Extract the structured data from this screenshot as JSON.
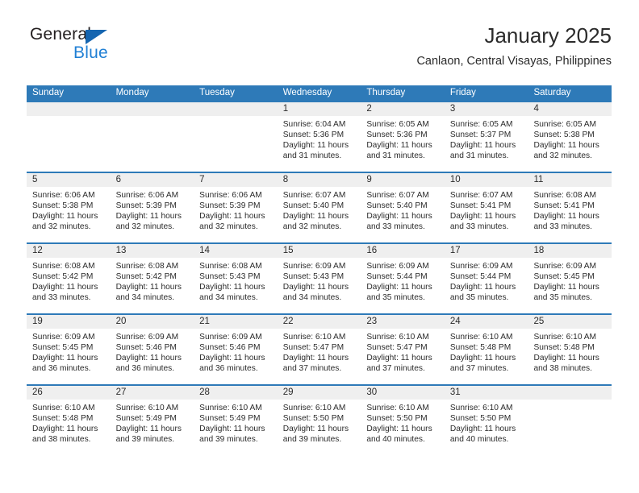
{
  "brand": {
    "name_top": "General",
    "name_bottom": "Blue",
    "triangle_color": "#1565b0",
    "blue_color": "#1f7fd4"
  },
  "header": {
    "title": "January 2025",
    "subtitle": "Canlaon, Central Visayas, Philippines"
  },
  "theme": {
    "header_blue": "#2e7ab8",
    "daynum_band": "#efefef",
    "text": "#2b2b2b"
  },
  "calendar": {
    "weekday_headers": [
      "Sunday",
      "Monday",
      "Tuesday",
      "Wednesday",
      "Thursday",
      "Friday",
      "Saturday"
    ],
    "weeks": [
      [
        {
          "day": "",
          "sunrise": "",
          "sunset": "",
          "daylight_line1": "",
          "daylight_line2": ""
        },
        {
          "day": "",
          "sunrise": "",
          "sunset": "",
          "daylight_line1": "",
          "daylight_line2": ""
        },
        {
          "day": "",
          "sunrise": "",
          "sunset": "",
          "daylight_line1": "",
          "daylight_line2": ""
        },
        {
          "day": "1",
          "sunrise": "Sunrise: 6:04 AM",
          "sunset": "Sunset: 5:36 PM",
          "daylight_line1": "Daylight: 11 hours",
          "daylight_line2": "and 31 minutes."
        },
        {
          "day": "2",
          "sunrise": "Sunrise: 6:05 AM",
          "sunset": "Sunset: 5:36 PM",
          "daylight_line1": "Daylight: 11 hours",
          "daylight_line2": "and 31 minutes."
        },
        {
          "day": "3",
          "sunrise": "Sunrise: 6:05 AM",
          "sunset": "Sunset: 5:37 PM",
          "daylight_line1": "Daylight: 11 hours",
          "daylight_line2": "and 31 minutes."
        },
        {
          "day": "4",
          "sunrise": "Sunrise: 6:05 AM",
          "sunset": "Sunset: 5:38 PM",
          "daylight_line1": "Daylight: 11 hours",
          "daylight_line2": "and 32 minutes."
        }
      ],
      [
        {
          "day": "5",
          "sunrise": "Sunrise: 6:06 AM",
          "sunset": "Sunset: 5:38 PM",
          "daylight_line1": "Daylight: 11 hours",
          "daylight_line2": "and 32 minutes."
        },
        {
          "day": "6",
          "sunrise": "Sunrise: 6:06 AM",
          "sunset": "Sunset: 5:39 PM",
          "daylight_line1": "Daylight: 11 hours",
          "daylight_line2": "and 32 minutes."
        },
        {
          "day": "7",
          "sunrise": "Sunrise: 6:06 AM",
          "sunset": "Sunset: 5:39 PM",
          "daylight_line1": "Daylight: 11 hours",
          "daylight_line2": "and 32 minutes."
        },
        {
          "day": "8",
          "sunrise": "Sunrise: 6:07 AM",
          "sunset": "Sunset: 5:40 PM",
          "daylight_line1": "Daylight: 11 hours",
          "daylight_line2": "and 32 minutes."
        },
        {
          "day": "9",
          "sunrise": "Sunrise: 6:07 AM",
          "sunset": "Sunset: 5:40 PM",
          "daylight_line1": "Daylight: 11 hours",
          "daylight_line2": "and 33 minutes."
        },
        {
          "day": "10",
          "sunrise": "Sunrise: 6:07 AM",
          "sunset": "Sunset: 5:41 PM",
          "daylight_line1": "Daylight: 11 hours",
          "daylight_line2": "and 33 minutes."
        },
        {
          "day": "11",
          "sunrise": "Sunrise: 6:08 AM",
          "sunset": "Sunset: 5:41 PM",
          "daylight_line1": "Daylight: 11 hours",
          "daylight_line2": "and 33 minutes."
        }
      ],
      [
        {
          "day": "12",
          "sunrise": "Sunrise: 6:08 AM",
          "sunset": "Sunset: 5:42 PM",
          "daylight_line1": "Daylight: 11 hours",
          "daylight_line2": "and 33 minutes."
        },
        {
          "day": "13",
          "sunrise": "Sunrise: 6:08 AM",
          "sunset": "Sunset: 5:42 PM",
          "daylight_line1": "Daylight: 11 hours",
          "daylight_line2": "and 34 minutes."
        },
        {
          "day": "14",
          "sunrise": "Sunrise: 6:08 AM",
          "sunset": "Sunset: 5:43 PM",
          "daylight_line1": "Daylight: 11 hours",
          "daylight_line2": "and 34 minutes."
        },
        {
          "day": "15",
          "sunrise": "Sunrise: 6:09 AM",
          "sunset": "Sunset: 5:43 PM",
          "daylight_line1": "Daylight: 11 hours",
          "daylight_line2": "and 34 minutes."
        },
        {
          "day": "16",
          "sunrise": "Sunrise: 6:09 AM",
          "sunset": "Sunset: 5:44 PM",
          "daylight_line1": "Daylight: 11 hours",
          "daylight_line2": "and 35 minutes."
        },
        {
          "day": "17",
          "sunrise": "Sunrise: 6:09 AM",
          "sunset": "Sunset: 5:44 PM",
          "daylight_line1": "Daylight: 11 hours",
          "daylight_line2": "and 35 minutes."
        },
        {
          "day": "18",
          "sunrise": "Sunrise: 6:09 AM",
          "sunset": "Sunset: 5:45 PM",
          "daylight_line1": "Daylight: 11 hours",
          "daylight_line2": "and 35 minutes."
        }
      ],
      [
        {
          "day": "19",
          "sunrise": "Sunrise: 6:09 AM",
          "sunset": "Sunset: 5:45 PM",
          "daylight_line1": "Daylight: 11 hours",
          "daylight_line2": "and 36 minutes."
        },
        {
          "day": "20",
          "sunrise": "Sunrise: 6:09 AM",
          "sunset": "Sunset: 5:46 PM",
          "daylight_line1": "Daylight: 11 hours",
          "daylight_line2": "and 36 minutes."
        },
        {
          "day": "21",
          "sunrise": "Sunrise: 6:09 AM",
          "sunset": "Sunset: 5:46 PM",
          "daylight_line1": "Daylight: 11 hours",
          "daylight_line2": "and 36 minutes."
        },
        {
          "day": "22",
          "sunrise": "Sunrise: 6:10 AM",
          "sunset": "Sunset: 5:47 PM",
          "daylight_line1": "Daylight: 11 hours",
          "daylight_line2": "and 37 minutes."
        },
        {
          "day": "23",
          "sunrise": "Sunrise: 6:10 AM",
          "sunset": "Sunset: 5:47 PM",
          "daylight_line1": "Daylight: 11 hours",
          "daylight_line2": "and 37 minutes."
        },
        {
          "day": "24",
          "sunrise": "Sunrise: 6:10 AM",
          "sunset": "Sunset: 5:48 PM",
          "daylight_line1": "Daylight: 11 hours",
          "daylight_line2": "and 37 minutes."
        },
        {
          "day": "25",
          "sunrise": "Sunrise: 6:10 AM",
          "sunset": "Sunset: 5:48 PM",
          "daylight_line1": "Daylight: 11 hours",
          "daylight_line2": "and 38 minutes."
        }
      ],
      [
        {
          "day": "26",
          "sunrise": "Sunrise: 6:10 AM",
          "sunset": "Sunset: 5:48 PM",
          "daylight_line1": "Daylight: 11 hours",
          "daylight_line2": "and 38 minutes."
        },
        {
          "day": "27",
          "sunrise": "Sunrise: 6:10 AM",
          "sunset": "Sunset: 5:49 PM",
          "daylight_line1": "Daylight: 11 hours",
          "daylight_line2": "and 39 minutes."
        },
        {
          "day": "28",
          "sunrise": "Sunrise: 6:10 AM",
          "sunset": "Sunset: 5:49 PM",
          "daylight_line1": "Daylight: 11 hours",
          "daylight_line2": "and 39 minutes."
        },
        {
          "day": "29",
          "sunrise": "Sunrise: 6:10 AM",
          "sunset": "Sunset: 5:50 PM",
          "daylight_line1": "Daylight: 11 hours",
          "daylight_line2": "and 39 minutes."
        },
        {
          "day": "30",
          "sunrise": "Sunrise: 6:10 AM",
          "sunset": "Sunset: 5:50 PM",
          "daylight_line1": "Daylight: 11 hours",
          "daylight_line2": "and 40 minutes."
        },
        {
          "day": "31",
          "sunrise": "Sunrise: 6:10 AM",
          "sunset": "Sunset: 5:50 PM",
          "daylight_line1": "Daylight: 11 hours",
          "daylight_line2": "and 40 minutes."
        },
        {
          "day": "",
          "sunrise": "",
          "sunset": "",
          "daylight_line1": "",
          "daylight_line2": ""
        }
      ]
    ]
  }
}
